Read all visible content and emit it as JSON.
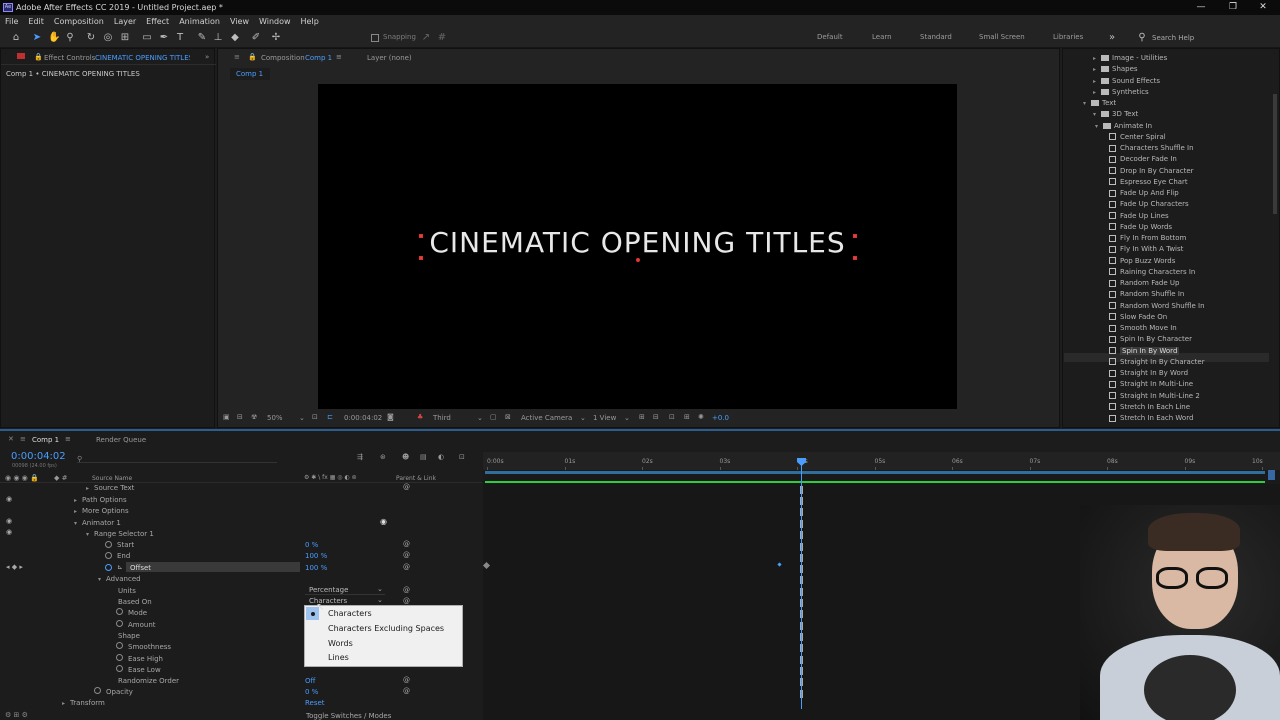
{
  "window": {
    "title": "Adobe After Effects CC 2019 - Untitled Project.aep *",
    "app_icon": "Ae",
    "controls": [
      "—",
      "❐",
      "✕"
    ]
  },
  "menu": [
    "File",
    "Edit",
    "Composition",
    "Layer",
    "Effect",
    "Animation",
    "View",
    "Window",
    "Help"
  ],
  "toolbar": {
    "snapping": "Snapping",
    "workspaces": [
      "Default",
      "Learn",
      "Standard",
      "Small Screen",
      "Libraries"
    ],
    "search_placeholder": "Search Help"
  },
  "effect_controls": {
    "tab": "Effect Controls",
    "layer": "CINEMATIC OPENING TITLES",
    "breadcrumb": "Comp 1 • CINEMATIC OPENING TITLES"
  },
  "composition": {
    "tab_prefix": "Composition",
    "comp": "Comp 1",
    "layer_tab": "Layer (none)",
    "subtab": "Comp 1",
    "text": "CINEMATIC OPENING TITLES"
  },
  "viewer_bar": {
    "zoom": "50%",
    "time": "0:00:04:02",
    "resolution": "Third",
    "camera": "Active Camera",
    "views": "1 View",
    "exposure": "+0.0"
  },
  "effects": {
    "categories": [
      "Image - Utilities",
      "Shapes",
      "Sound Effects",
      "Synthetics",
      "Text",
      "3D Text",
      "Animate In"
    ],
    "presets": [
      "Center Spiral",
      "Characters Shuffle In",
      "Decoder Fade In",
      "Drop In By Character",
      "Espresso Eye Chart",
      "Fade Up And Flip",
      "Fade Up Characters",
      "Fade Up Lines",
      "Fade Up Words",
      "Fly In From Bottom",
      "Fly In With A Twist",
      "Pop Buzz Words",
      "Raining Characters In",
      "Random Fade Up",
      "Random Shuffle In",
      "Random Word Shuffle In",
      "Slow Fade On",
      "Smooth Move In",
      "Spin In By Character",
      "Spin In By Word",
      "Straight In By Character",
      "Straight In By Word",
      "Straight In Multi-Line",
      "Straight In Multi-Line 2",
      "Stretch In Each Line",
      "Stretch In Each Word"
    ],
    "selected": "Spin In By Word"
  },
  "timeline": {
    "tabs": [
      "Comp 1",
      "Render Queue"
    ],
    "timecode": "0:00:04:02",
    "col_source": "Source Name",
    "col_parent": "Parent & Link",
    "ruler": [
      "0:00s",
      "01s",
      "02s",
      "03s",
      "04s",
      "05s",
      "06s",
      "07s",
      "08s",
      "09s",
      "10s"
    ],
    "current_time_s": 4.07,
    "add_label": "Add:",
    "rows": {
      "source_text": "Source Text",
      "path_options": "Path Options",
      "more_options": "More Options",
      "animator": "Animator 1",
      "range_selector": "Range Selector 1",
      "start": "Start",
      "start_val": "0 %",
      "end": "End",
      "end_val": "100 %",
      "offset": "Offset",
      "offset_val": "100 %",
      "advanced": "Advanced",
      "units": "Units",
      "units_val": "Percentage",
      "based_on": "Based On",
      "based_on_val": "Characters",
      "mode": "Mode",
      "amount": "Amount",
      "shape": "Shape",
      "smoothness": "Smoothness",
      "ease_high": "Ease High",
      "ease_low": "Ease Low",
      "randomize": "Randomize Order",
      "randomize_val": "Off",
      "opacity": "Opacity",
      "opacity_val": "0 %",
      "transform": "Transform",
      "transform_val": "Reset"
    },
    "toggle": "Toggle Switches / Modes"
  },
  "dropdown": {
    "options": [
      "Characters",
      "Characters Excluding Spaces",
      "Words",
      "Lines"
    ],
    "selected": "Characters"
  },
  "colors": {
    "accent": "#4a9dff",
    "work_area": "#2ecc40",
    "panel": "#1c1c1c"
  }
}
